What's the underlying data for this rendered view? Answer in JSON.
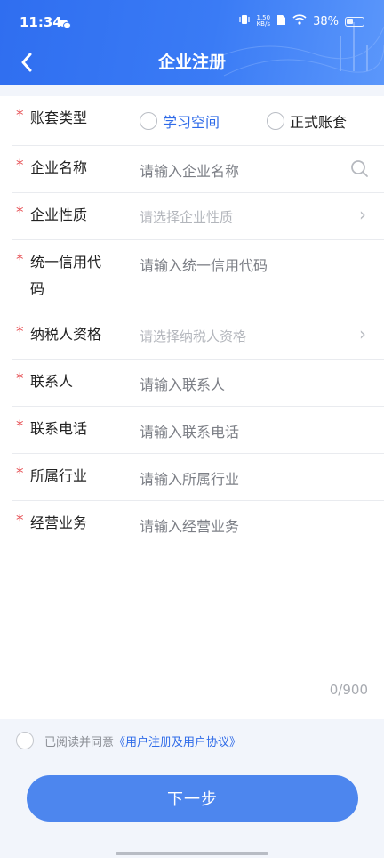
{
  "status_bar": {
    "time": "11:34",
    "speed_top": "1.50",
    "speed_bottom": "KB/s",
    "battery": "38%"
  },
  "header": {
    "title": "企业注册"
  },
  "form": {
    "account_type": {
      "label": "账套类型",
      "options": [
        "学习空间",
        "正式账套"
      ]
    },
    "company_name": {
      "label": "企业名称",
      "placeholder": "请输入企业名称"
    },
    "company_nature": {
      "label": "企业性质",
      "placeholder": "请选择企业性质"
    },
    "credit_code": {
      "label_line1": "统一信用代",
      "label_line2": "码",
      "placeholder": "请输入统一信用代码"
    },
    "taxpayer": {
      "label": "纳税人资格",
      "placeholder": "请选择纳税人资格"
    },
    "contact": {
      "label": "联系人",
      "placeholder": "请输入联系人"
    },
    "phone": {
      "label": "联系电话",
      "placeholder": "请输入联系电话"
    },
    "industry": {
      "label": "所属行业",
      "placeholder": "请输入所属行业"
    },
    "business": {
      "label": "经营业务",
      "placeholder": "请输入经营业务",
      "counter": "0/900"
    }
  },
  "agreement": {
    "prefix": "已阅读并同意",
    "link": "《用户注册及用户协议》"
  },
  "next_button": "下一步",
  "colors": {
    "primary": "#3a7bf5",
    "required": "#e5484d",
    "button": "#4d86ee"
  }
}
